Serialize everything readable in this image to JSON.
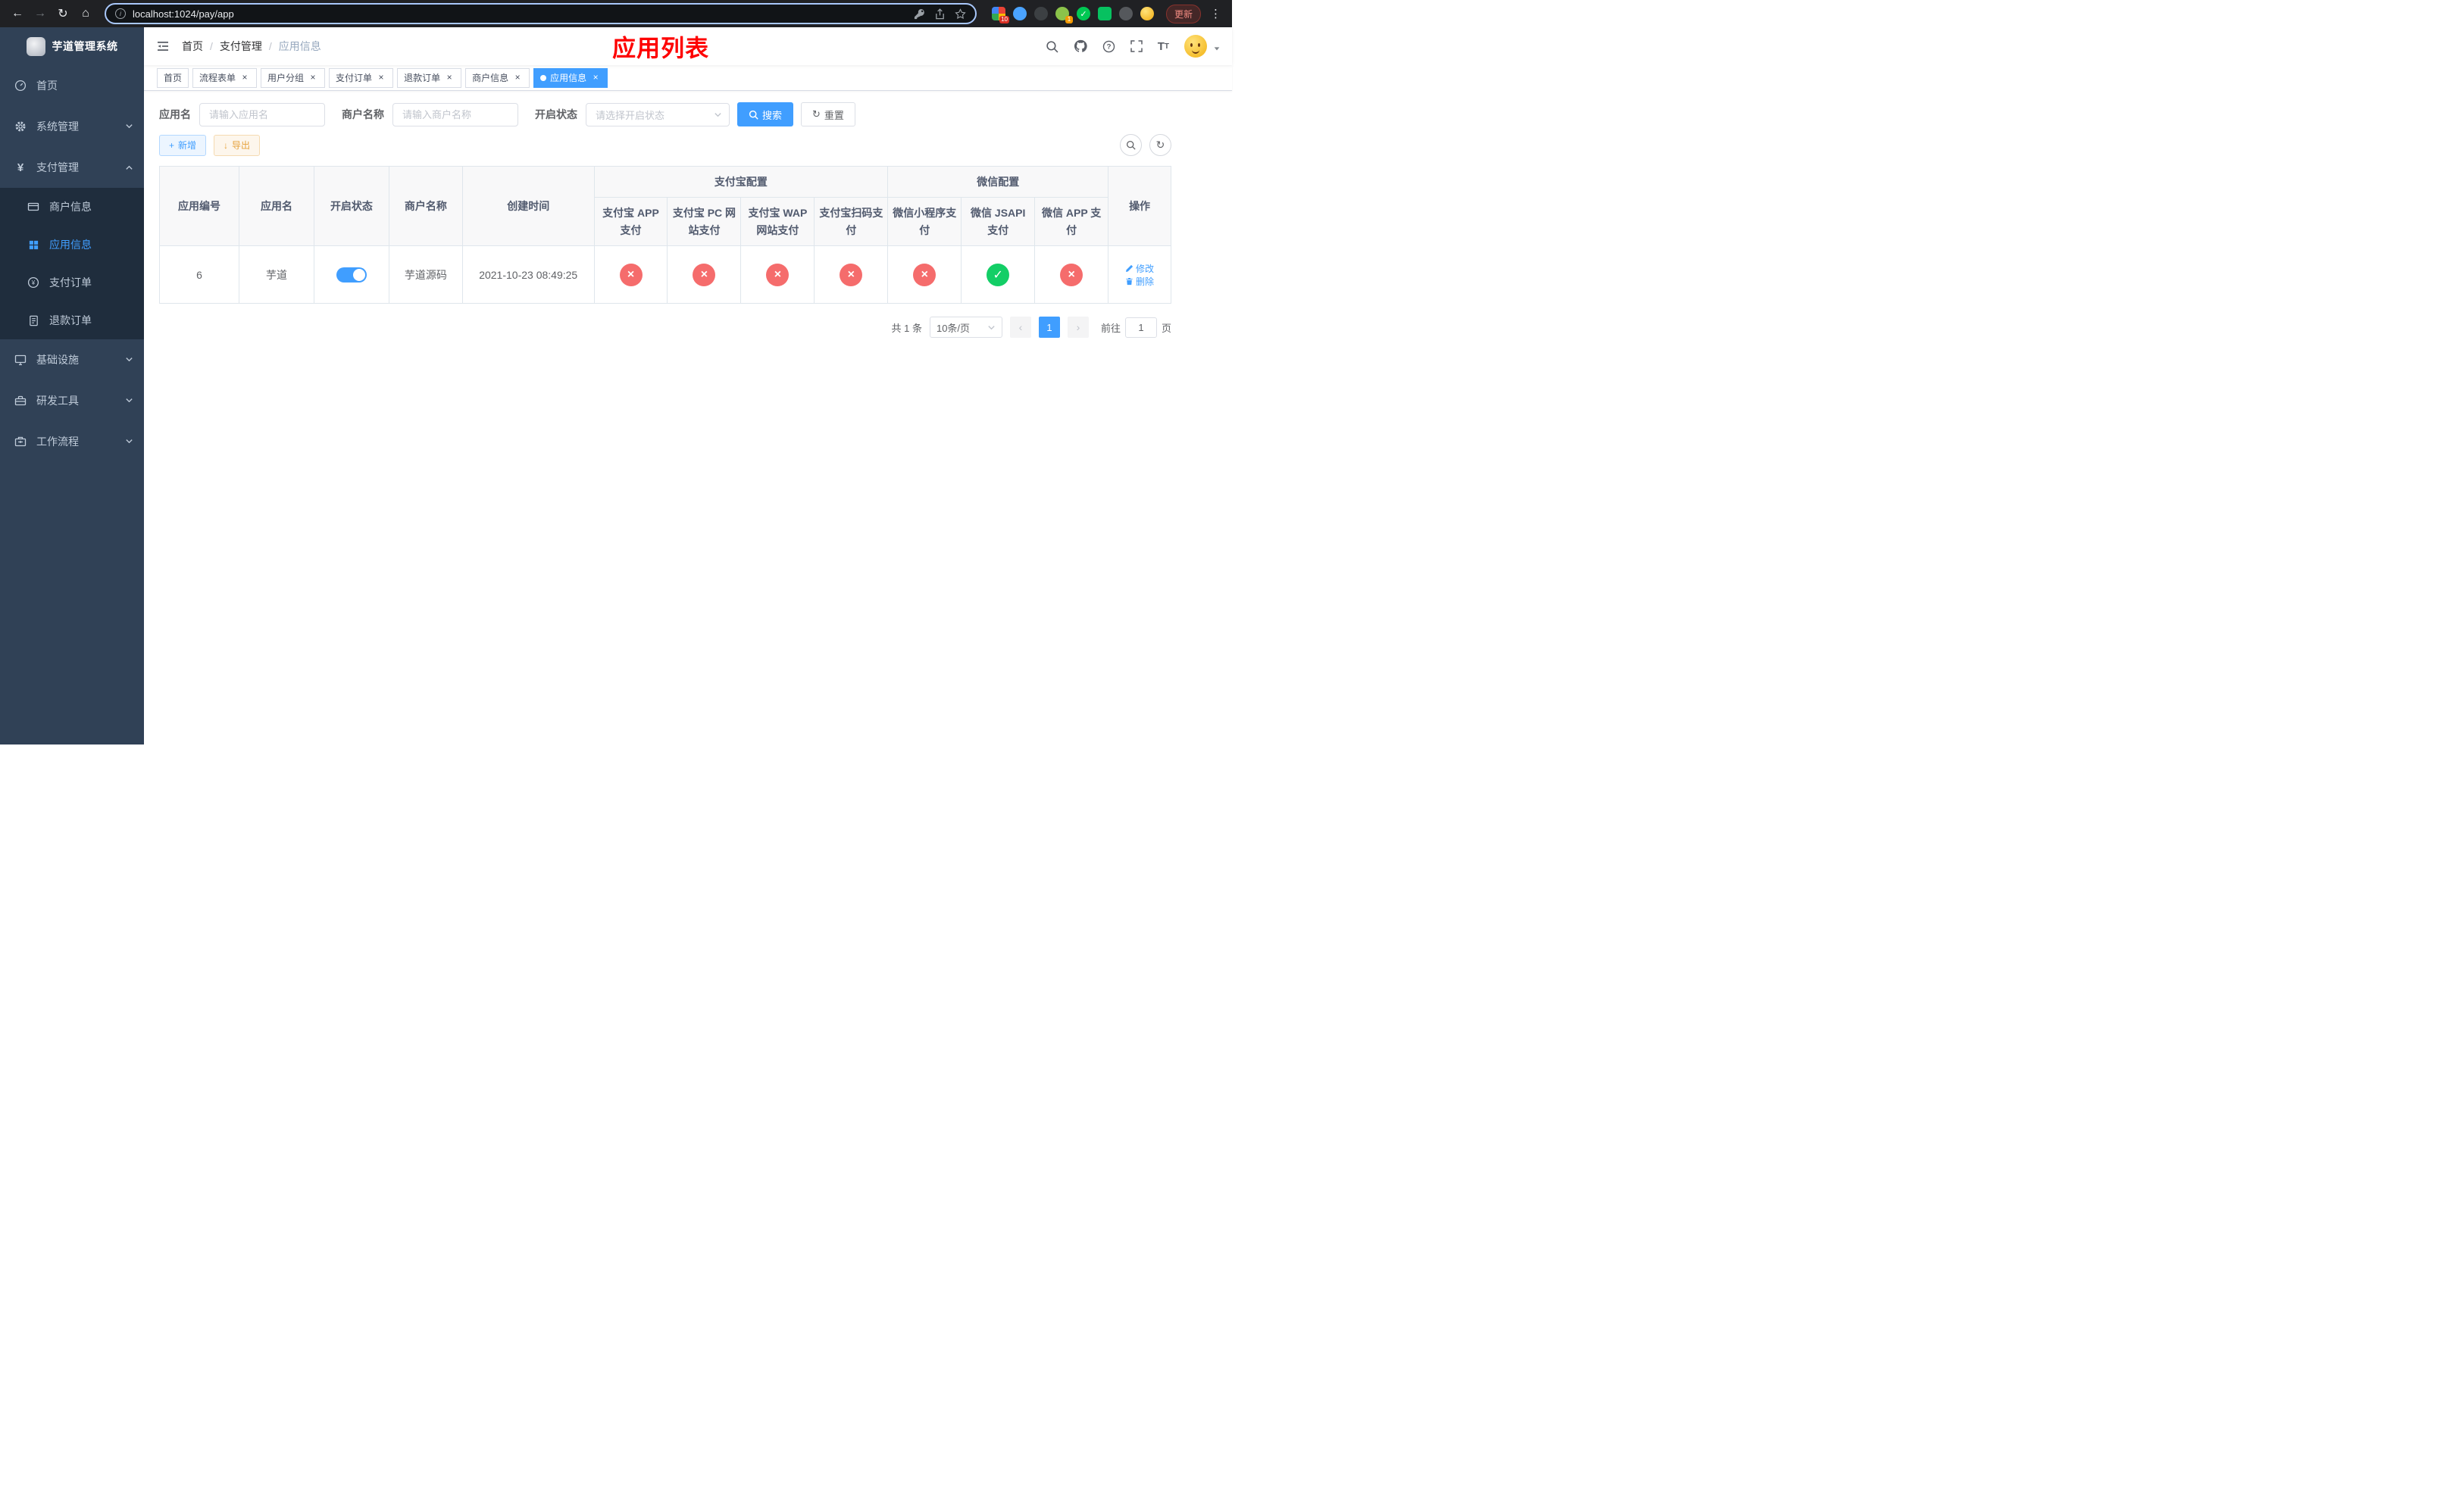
{
  "colors": {
    "primary": "#409eff",
    "success": "#13ce66",
    "danger": "#f56c6c",
    "warning": "#e6a23c",
    "title_red": "#fe0000",
    "sidebar_bg": "#304156",
    "submenu_bg": "#1f2d3d"
  },
  "browser": {
    "url": "localhost:1024/pay/app",
    "update_label": "更新",
    "extension_badge_grid": "10",
    "extension_badge_avatar": "1"
  },
  "sidebar": {
    "title": "芋道管理系统",
    "home": "首页",
    "system": "系统管理",
    "payment": "支付管理",
    "infrastructure": "基础设施",
    "devtools": "研发工具",
    "workflow": "工作流程",
    "sub_merchant": "商户信息",
    "sub_app_info": "应用信息",
    "sub_pay_order": "支付订单",
    "sub_refund_order": "退款订单"
  },
  "header": {
    "breadcrumb": [
      "首页",
      "支付管理",
      "应用信息"
    ],
    "page_title": "应用列表"
  },
  "tabs": [
    {
      "label": "首页"
    },
    {
      "label": "流程表单"
    },
    {
      "label": "用户分组"
    },
    {
      "label": "支付订单"
    },
    {
      "label": "退款订单"
    },
    {
      "label": "商户信息"
    },
    {
      "label": "应用信息"
    }
  ],
  "filters": {
    "app_name_label": "应用名",
    "app_name_placeholder": "请输入应用名",
    "merchant_label": "商户名称",
    "merchant_placeholder": "请输入商户名称",
    "status_label": "开启状态",
    "status_placeholder": "请选择开启状态",
    "search_label": "搜索",
    "reset_label": "重置"
  },
  "toolbar": {
    "add_label": "新增",
    "export_label": "导出"
  },
  "table": {
    "alipay_group": "支付宝配置",
    "wechat_group": "微信配置",
    "col_id": "应用编号",
    "col_name": "应用名",
    "col_status": "开启状态",
    "col_merchant": "商户名称",
    "col_created": "创建时间",
    "col_actions": "操作",
    "pay_columns": [
      "支付宝 APP 支付",
      "支付宝 PC 网站支付",
      "支付宝 WAP 网站支付",
      "支付宝扫码支付",
      "微信小程序支付",
      "微信 JSAPI 支付",
      "微信 APP 支付"
    ],
    "rows": [
      {
        "id": "6",
        "name": "芋道",
        "enabled": true,
        "merchant": "芋道源码",
        "created": "2021-10-23 08:49:25",
        "pay_status": [
          false,
          false,
          false,
          false,
          false,
          true,
          false
        ],
        "edit_label": "修改",
        "delete_label": "删除"
      }
    ]
  },
  "pagination": {
    "total": "共 1 条",
    "page_size": "10条/页",
    "current_page": "1",
    "goto_prefix": "前往",
    "goto_value": "1",
    "goto_suffix": "页"
  }
}
